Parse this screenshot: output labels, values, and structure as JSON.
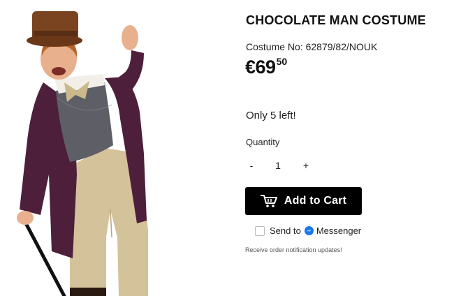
{
  "product": {
    "title": "CHOCOLATE MAN COSTUME",
    "costume_no": "Costume No: 62879/82/NOUK",
    "price_main": "€69",
    "price_cents": "50",
    "stock": "Only 5 left!"
  },
  "quantity": {
    "label": "Quantity",
    "minus": "-",
    "value": "1",
    "plus": "+"
  },
  "cart": {
    "label": "Add to Cart",
    "icon": "cart-icon",
    "background": "#000000"
  },
  "messenger": {
    "send_label": "Send to",
    "messenger_label": "Messenger",
    "icon": "messenger-icon",
    "icon_color": "#1877f2",
    "note": "Receive order notification updates!"
  },
  "colors": {
    "jacket": "#4e1f3a",
    "trousers": "#d4c29a",
    "hat": "#7a4420"
  }
}
